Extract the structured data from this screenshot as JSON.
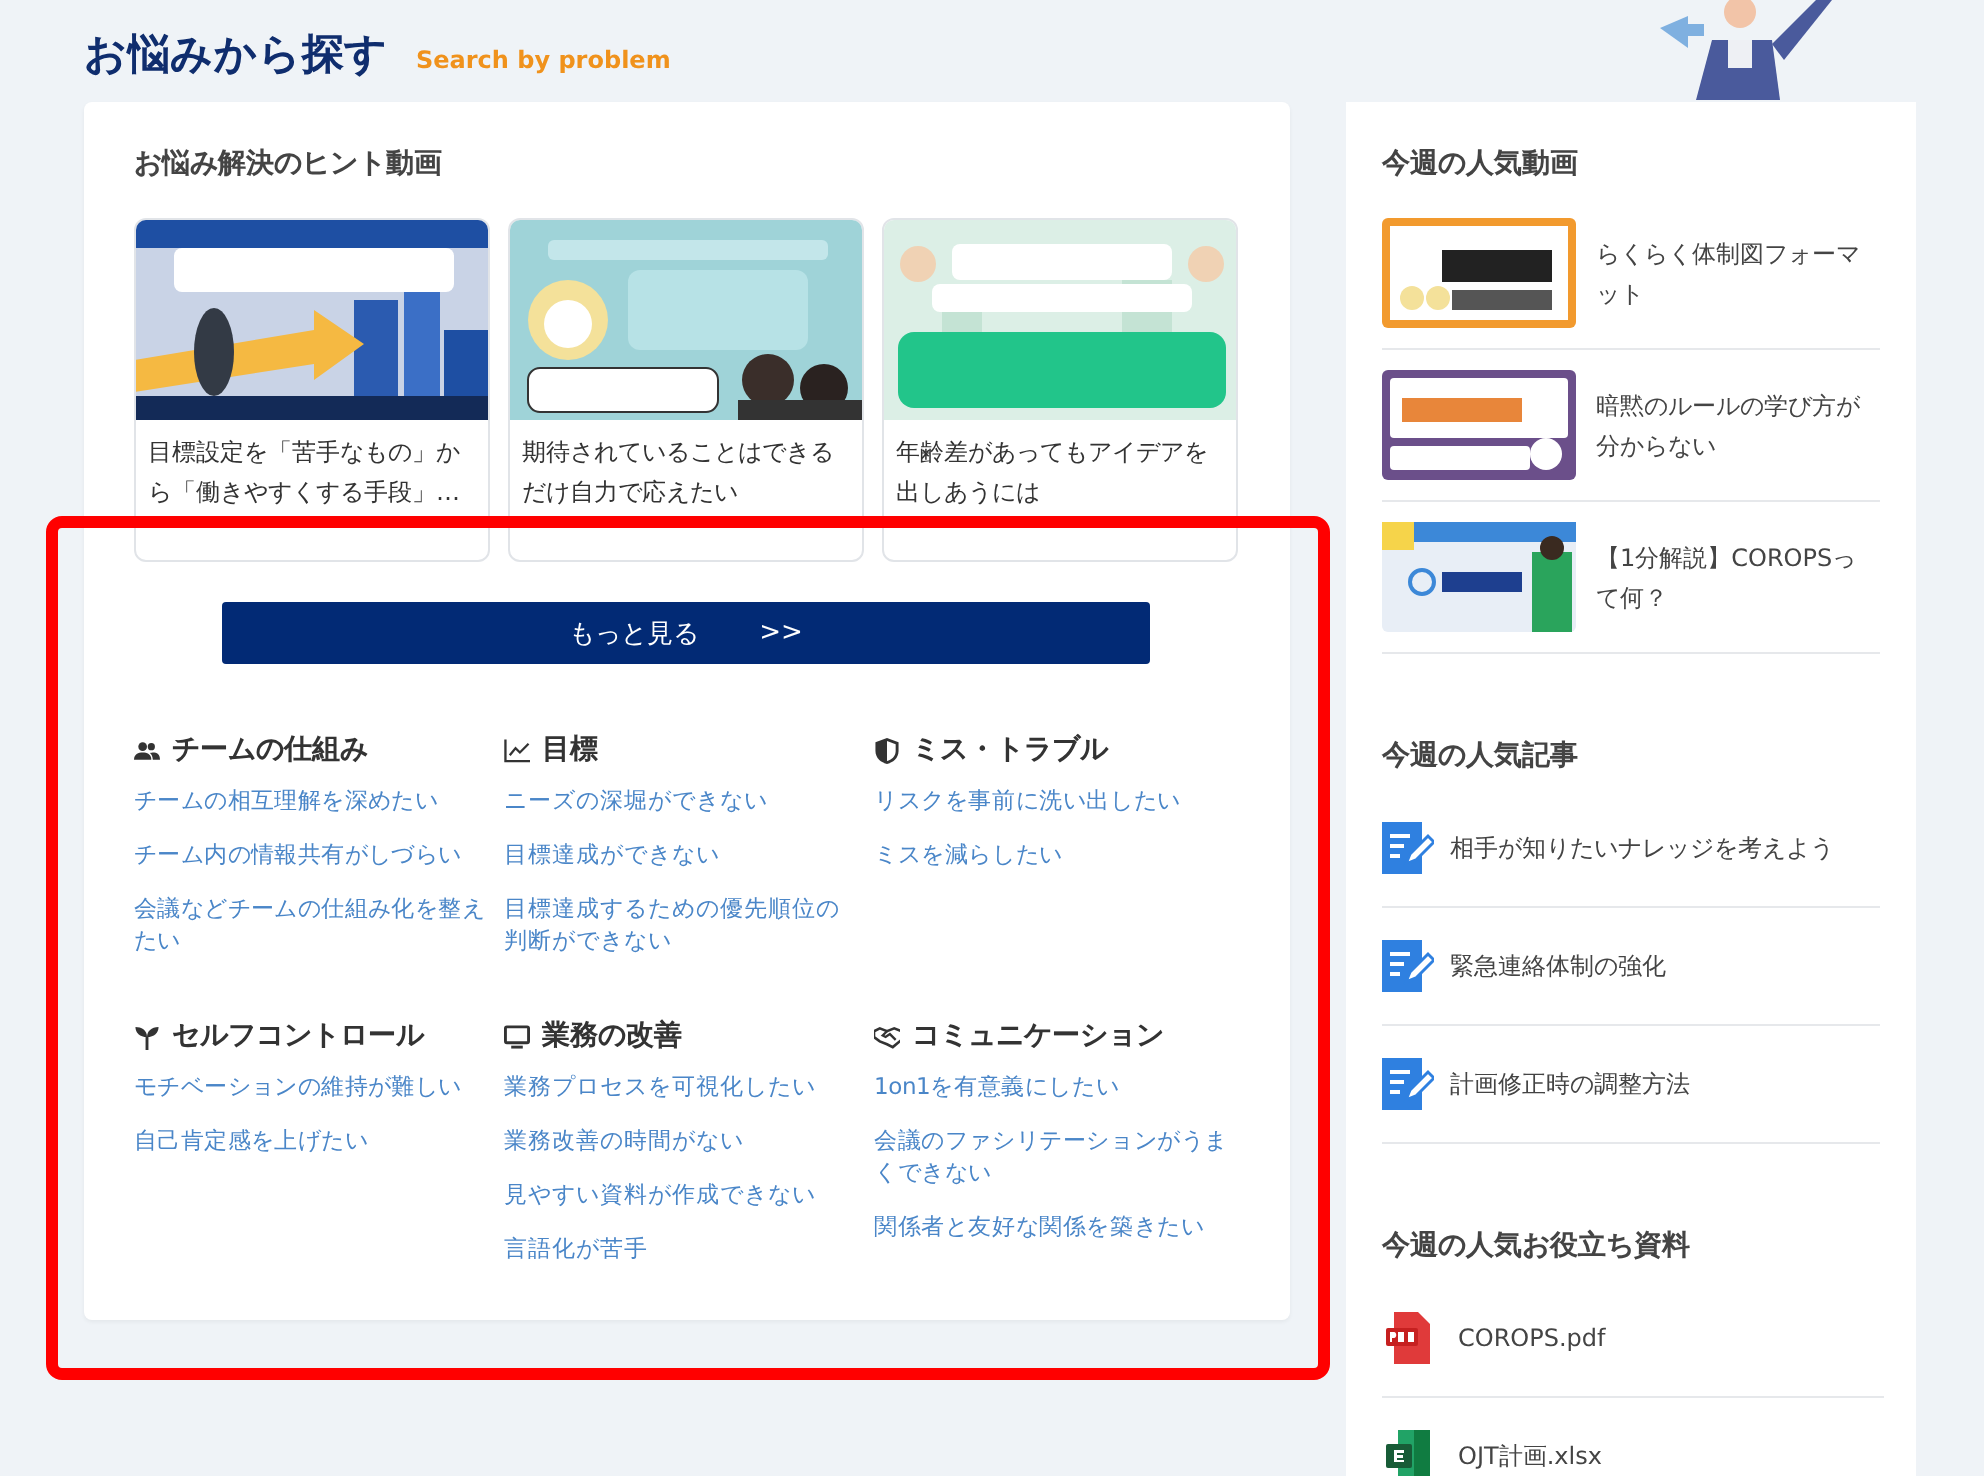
{
  "header": {
    "title": "お悩みから探す",
    "subtitle": "Search by problem"
  },
  "hint_videos": {
    "title": "お悩み解決のヒント動画",
    "items": [
      {
        "caption": "目標設定を「苦手なもの」から「働きやすくする手段」…"
      },
      {
        "caption": "期待されていることはできるだけ自力で応えたい"
      },
      {
        "caption": "年齢差があってもアイデアを出しあうには"
      }
    ],
    "more_button": {
      "label": "もっと見る",
      "arrow": ">>"
    }
  },
  "categories": [
    {
      "kind": "people",
      "title": "チームの仕組み",
      "links": [
        "チームの相互理解を深めたい",
        "チーム内の情報共有がしづらい",
        "会議などチームの仕組み化を整えたい"
      ]
    },
    {
      "kind": "chart",
      "title": "目標",
      "links": [
        "ニーズの深堀ができない",
        "目標達成ができない",
        "目標達成するための優先順位の判断ができない"
      ]
    },
    {
      "kind": "shield",
      "title": "ミス・トラブル",
      "links": [
        "リスクを事前に洗い出したい",
        "ミスを減らしたい"
      ]
    },
    {
      "kind": "sprout",
      "title": "セルフコントロール",
      "links": [
        "モチベーションの維持が難しい",
        "自己肯定感を上げたい"
      ]
    },
    {
      "kind": "monitor",
      "title": "業務の改善",
      "links": [
        "業務プロセスを可視化したい",
        "業務改善の時間がない",
        "見やすい資料が作成できない",
        "言語化が苦手"
      ]
    },
    {
      "kind": "handshake",
      "title": "コミュニケーション",
      "links": [
        "1on1を有意義にしたい",
        "会議のファシリテーションがうまくできない",
        "関係者と友好な関係を築きたい"
      ]
    }
  ],
  "sidebar": {
    "popular_videos": {
      "title": "今週の人気動画",
      "items": [
        {
          "title": "らくらく体制図フォーマット",
          "color": "#f29a2e"
        },
        {
          "title": "暗黙のルールの学び方が分からない",
          "color": "#6b4f8a"
        },
        {
          "title": "【1分解説】COROPSって何？",
          "color": "#e8eef6"
        }
      ]
    },
    "popular_articles": {
      "title": "今週の人気記事",
      "items": [
        "相手が知りたいナレッジを考えよう",
        "緊急連絡体制の強化",
        "計画修正時の調整方法"
      ]
    },
    "popular_resources": {
      "title": "今週の人気お役立ち資料",
      "items": [
        {
          "kind": "pdf",
          "name": "COROPS.pdf"
        },
        {
          "kind": "xlsx",
          "name": "OJT計画.xlsx"
        }
      ]
    }
  },
  "annotation": {
    "kind": "highlight-rect",
    "color": "#ff0000"
  }
}
